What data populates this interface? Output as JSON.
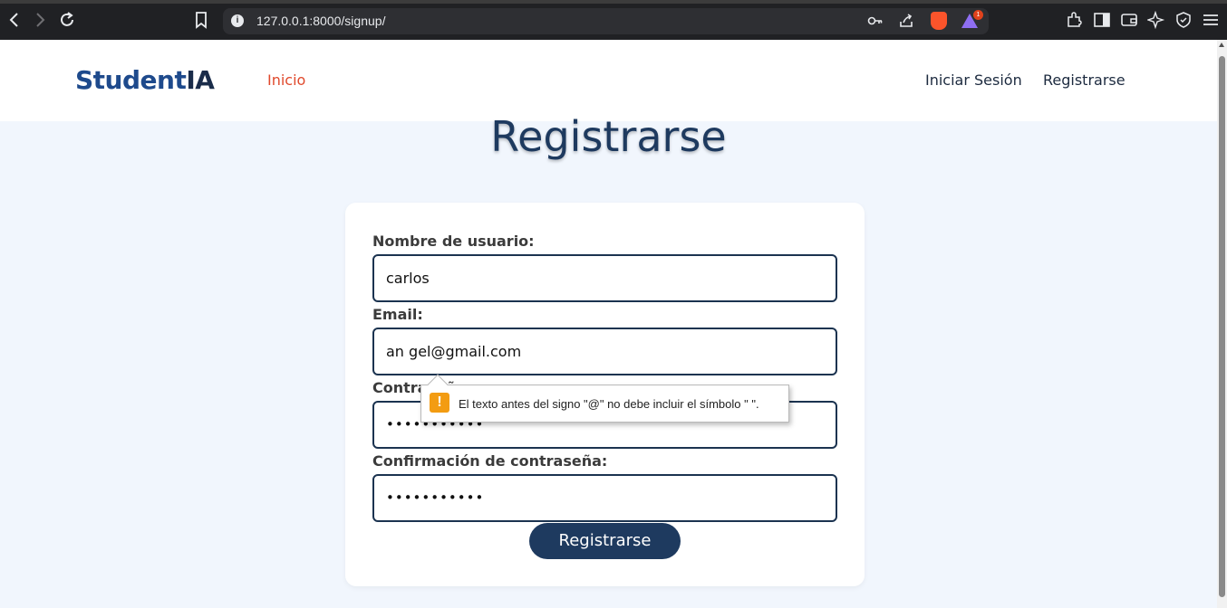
{
  "browser": {
    "url": "127.0.0.1:8000/signup/",
    "rewards_badge": "1"
  },
  "header": {
    "logo_part1": "Student",
    "logo_part2": "IA",
    "nav_home": "Inicio",
    "nav_login": "Iniciar Sesión",
    "nav_register": "Registrarse"
  },
  "page": {
    "title": "Registrarse"
  },
  "form": {
    "username_label": "Nombre de usuario:",
    "username_value": "carlos",
    "email_label": "Email:",
    "email_value": "an gel@gmail.com",
    "password_label": "Contraseña:",
    "password_value": "•••••••••••",
    "confirm_label": "Confirmación de contraseña:",
    "confirm_value": "•••••••••••",
    "submit_label": "Registrarse"
  },
  "validation": {
    "message": "El texto antes del signo \"@\" no debe incluir el símbolo \" \".",
    "icon_text": "!"
  }
}
